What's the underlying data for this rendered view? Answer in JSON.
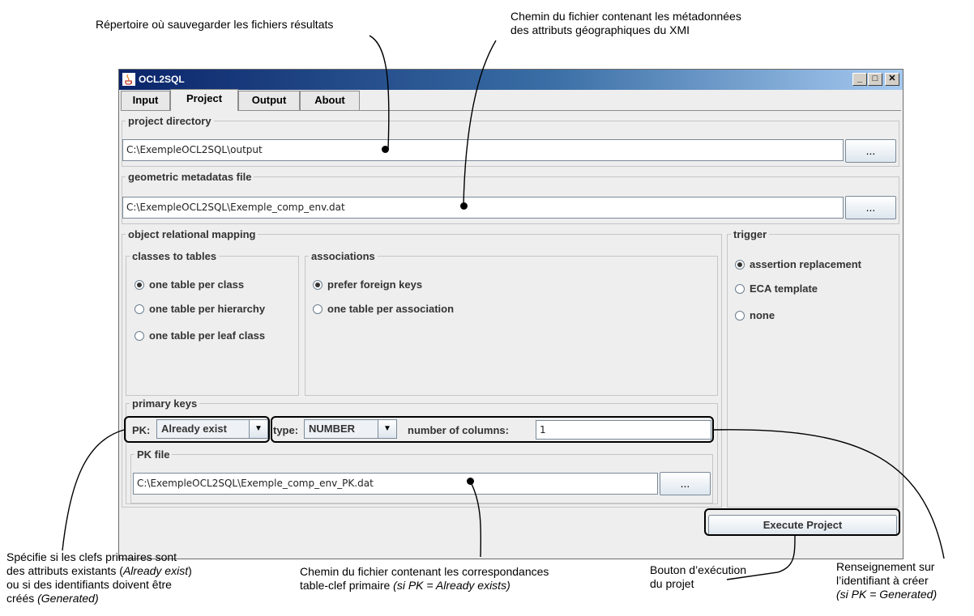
{
  "window": {
    "title": "OCL2SQL",
    "controls": {
      "minimize": "_",
      "maximize": "□",
      "close": "✕"
    }
  },
  "tabs": [
    {
      "label": "Input",
      "active": false
    },
    {
      "label": "Project",
      "active": true
    },
    {
      "label": "Output",
      "active": false
    },
    {
      "label": "About",
      "active": false
    }
  ],
  "project_directory": {
    "legend": "project directory",
    "value": "C:\\ExempleOCL2SQL\\output",
    "browse_label": "..."
  },
  "geometric_metadatas": {
    "legend": "geometric metadatas file",
    "value": "C:\\ExempleOCL2SQL\\Exemple_comp_env.dat",
    "browse_label": "..."
  },
  "orm": {
    "legend": "object relational mapping",
    "classes_to_tables": {
      "legend": "classes to tables",
      "options": [
        {
          "label": "one table per class",
          "selected": true
        },
        {
          "label": "one table per hierarchy",
          "selected": false
        },
        {
          "label": "one table per leaf class",
          "selected": false
        }
      ]
    },
    "associations": {
      "legend": "associations",
      "options": [
        {
          "label": "prefer foreign keys",
          "selected": true
        },
        {
          "label": "one table per association",
          "selected": false
        }
      ]
    },
    "primary_keys": {
      "legend": "primary keys",
      "pk_label": "PK:",
      "pk_value": "Already exist",
      "type_label": "type:",
      "type_value": "NUMBER",
      "columns_label": "number of columns:",
      "columns_value": "1",
      "pk_file": {
        "legend": "PK file",
        "value": "C:\\ExempleOCL2SQL\\Exemple_comp_env_PK.dat",
        "browse_label": "..."
      }
    }
  },
  "trigger": {
    "legend": "trigger",
    "options": [
      {
        "label": "assertion replacement",
        "selected": true
      },
      {
        "label": "ECA template",
        "selected": false
      },
      {
        "label": "none",
        "selected": false
      }
    ]
  },
  "execute_button": "Execute Project",
  "annotations": {
    "project_dir": "Répertoire où sauvegarder les fichiers résultats",
    "metadata_line1": "Chemin du fichier contenant les métadonnées",
    "metadata_line2": "des attributs géographiques du XMI",
    "pk_line1": "Spécifie si les clefs primaires sont",
    "pk_line2_a": "des attributs existants (",
    "pk_line2_b": "Already exist",
    "pk_line2_c": ")",
    "pk_line3": "ou si des identifiants doivent être",
    "pk_line4_a": "créés ",
    "pk_line4_b": "(Generated)",
    "pkfile_line1": "Chemin du fichier contenant les correspondances",
    "pkfile_line2_a": "table-clef primaire ",
    "pkfile_line2_b": "(si PK = Already exists)",
    "exec_line1": "Bouton d’exécution",
    "exec_line2": "du projet",
    "gen_line1": "Renseignement sur",
    "gen_line2": "l’identifiant à créer",
    "gen_line3": "(si PK = Generated)"
  }
}
